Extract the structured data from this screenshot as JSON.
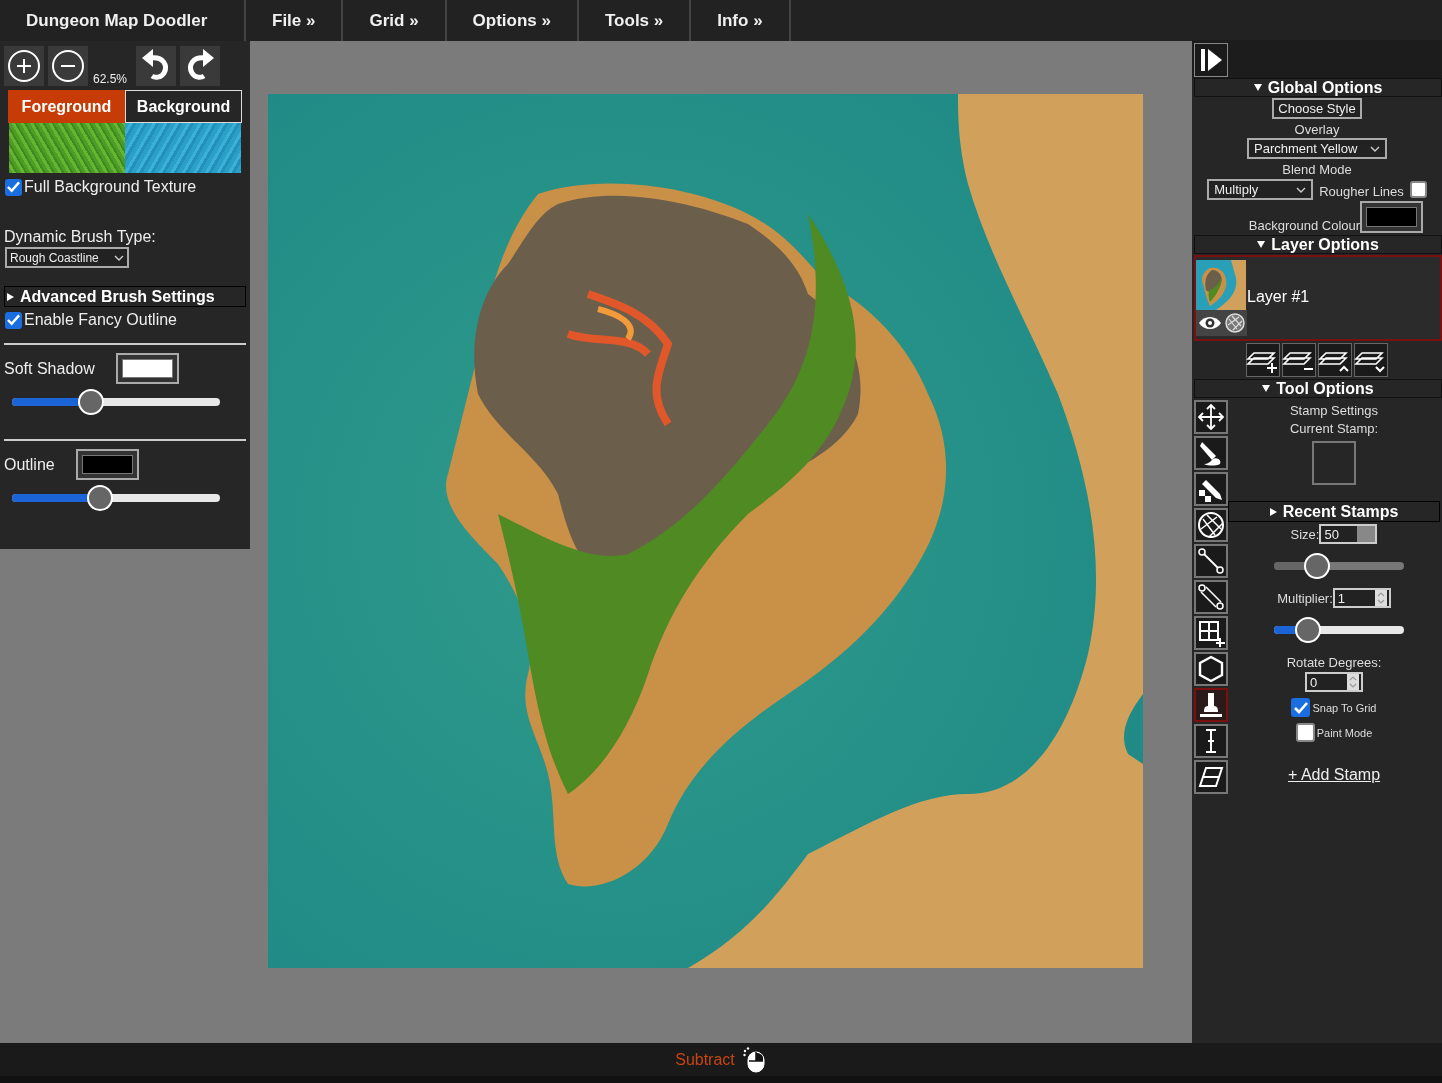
{
  "menu": [
    {
      "label": "Dungeon Map Doodler",
      "kind": "brand"
    },
    {
      "label": "File »",
      "kind": "menu"
    },
    {
      "label": "Grid »",
      "kind": "menu"
    },
    {
      "label": "Options »",
      "kind": "menu"
    },
    {
      "label": "Tools »",
      "kind": "menu"
    },
    {
      "label": "Info »",
      "kind": "menu"
    }
  ],
  "left_panel": {
    "zoom_level": "62.5%",
    "tabs": [
      {
        "label": "Foreground",
        "selected": true
      },
      {
        "label": "Background",
        "selected": false
      }
    ],
    "full_background_texture": {
      "label": "Full Background Texture",
      "checked": true
    },
    "brush_type": {
      "label": "Dynamic Brush Type:",
      "value": "Rough Coastline"
    },
    "advanced_brush_settings": {
      "title": "Advanced Brush Settings",
      "expanded": false
    },
    "fancy_outline": {
      "label": "Enable Fancy Outline",
      "checked": true
    },
    "effects": [
      {
        "label": "Soft Shadow",
        "color": "#ffffff",
        "level": 0.36
      },
      {
        "label": "Outline",
        "color": "#000000",
        "level": 0.41
      }
    ]
  },
  "status_bar": {
    "mode": "Subtract"
  },
  "right_panel": {
    "global_options": {
      "title": "Global Options",
      "expanded": true,
      "choose_style": "Choose Style",
      "overlay_label": "Overlay",
      "overlay": "Parchment Yellow",
      "blend_label": "Blend Mode",
      "blend_mode": "Multiply",
      "rougher_lines": {
        "label": "Rougher Lines",
        "checked": false
      },
      "background_colour": {
        "label": "Background Colour",
        "color": "#000000"
      }
    },
    "layer_options": {
      "title": "Layer Options",
      "expanded": true,
      "layers": [
        {
          "name": "Layer #1",
          "selected": true,
          "visible": true
        }
      ]
    },
    "tool_options": {
      "title": "Tool Options",
      "expanded": true,
      "tools": [
        {
          "kind": "move",
          "selected": false
        },
        {
          "kind": "brush",
          "selected": false
        },
        {
          "kind": "pencil",
          "selected": false
        },
        {
          "kind": "texture",
          "selected": false
        },
        {
          "kind": "line",
          "selected": false
        },
        {
          "kind": "path",
          "selected": false
        },
        {
          "kind": "grid",
          "selected": false
        },
        {
          "kind": "polygon",
          "selected": false
        },
        {
          "kind": "stamp",
          "selected": true
        },
        {
          "kind": "text",
          "selected": false
        },
        {
          "kind": "eraser",
          "selected": false
        }
      ],
      "settings_title": "Stamp Settings",
      "current_stamp_label": "Current Stamp:",
      "recent_stamps": {
        "title": "Recent Stamps",
        "expanded": false
      },
      "size": {
        "label": "Size:",
        "value": "50",
        "level": 0.29
      },
      "multiplier": {
        "label": "Multiplier:",
        "value": "1",
        "level": 0.2
      },
      "rotate": {
        "label": "Rotate Degrees:",
        "value": "0"
      },
      "snap_to_grid": {
        "label": "Snap To Grid",
        "checked": true
      },
      "paint_mode": {
        "label": "Paint Mode",
        "checked": false
      },
      "add_stamp": "+ Add Stamp"
    }
  }
}
